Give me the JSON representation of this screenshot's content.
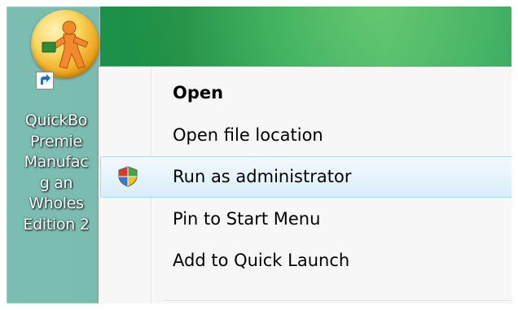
{
  "desktop_icon": {
    "label_lines": [
      "QuickBo",
      "Premie",
      "Manufac",
      "g an",
      "Wholes",
      "Edition 2"
    ],
    "icon": "quickbooks-app-icon",
    "overlay_icon": "shortcut-arrow-icon",
    "selected": true
  },
  "context_menu": {
    "items": [
      {
        "label": "Open",
        "default": true,
        "highlighted": false,
        "icon": null
      },
      {
        "label": "Open file location",
        "default": false,
        "highlighted": false,
        "icon": null
      },
      {
        "label": "Run as administrator",
        "default": false,
        "highlighted": true,
        "icon": "uac-shield-icon"
      },
      {
        "label": "Pin to Start Menu",
        "default": false,
        "highlighted": false,
        "icon": null
      },
      {
        "label": "Add to Quick Launch",
        "default": false,
        "highlighted": false,
        "icon": null
      }
    ]
  },
  "colors": {
    "desktop_green": "#1f9a4f",
    "menu_background": "#f7f7f7",
    "highlight_border": "#a8d8eb",
    "selection_tint": "#96c8cd"
  }
}
